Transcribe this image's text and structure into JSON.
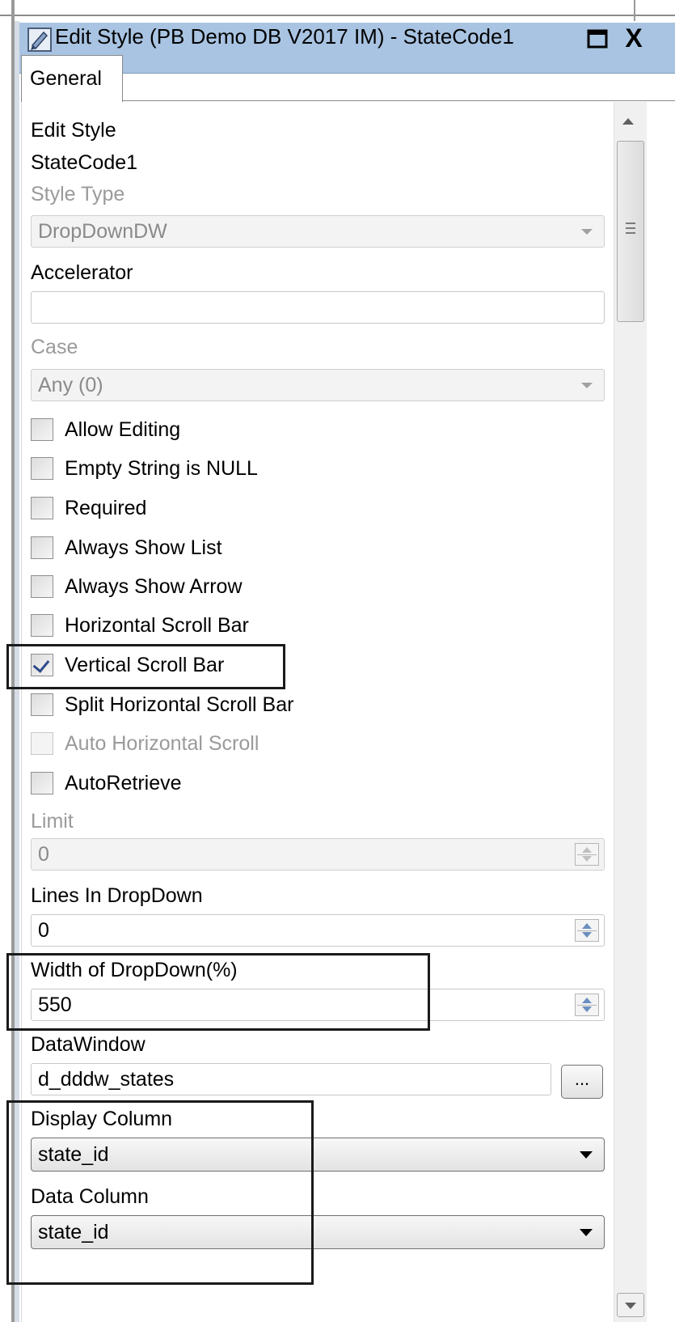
{
  "window": {
    "title": "Edit Style (PB Demo DB V2017 IM) - StateCode1",
    "close_label": "X"
  },
  "tabs": [
    {
      "label": "General"
    }
  ],
  "panel": {
    "heading": "Edit Style",
    "column_name": "StateCode1",
    "style_type": {
      "label": "Style Type",
      "value": "DropDownDW"
    },
    "accelerator": {
      "label": "Accelerator",
      "value": ""
    },
    "case": {
      "label": "Case",
      "value": "Any (0)"
    },
    "checkboxes": [
      {
        "label": "Allow Editing",
        "checked": false,
        "enabled": true
      },
      {
        "label": "Empty String is NULL",
        "checked": false,
        "enabled": true
      },
      {
        "label": "Required",
        "checked": false,
        "enabled": true
      },
      {
        "label": "Always Show List",
        "checked": false,
        "enabled": true
      },
      {
        "label": "Always Show Arrow",
        "checked": false,
        "enabled": true
      },
      {
        "label": "Horizontal Scroll Bar",
        "checked": false,
        "enabled": true
      },
      {
        "label": "Vertical Scroll Bar",
        "checked": true,
        "enabled": true
      },
      {
        "label": "Split Horizontal Scroll Bar",
        "checked": false,
        "enabled": true
      },
      {
        "label": "Auto Horizontal Scroll",
        "checked": false,
        "enabled": false
      },
      {
        "label": "AutoRetrieve",
        "checked": false,
        "enabled": true
      }
    ],
    "limit": {
      "label": "Limit",
      "value": "0"
    },
    "lines_in_dropdown": {
      "label": "Lines In DropDown",
      "value": "0"
    },
    "width_of_dropdown": {
      "label": "Width of DropDown(%)",
      "value": "550"
    },
    "datawindow": {
      "label": "DataWindow",
      "value": "d_dddw_states",
      "browse_label": "..."
    },
    "display_column": {
      "label": "Display Column",
      "value": "state_id"
    },
    "data_column": {
      "label": "Data Column",
      "value": "state_id"
    }
  }
}
